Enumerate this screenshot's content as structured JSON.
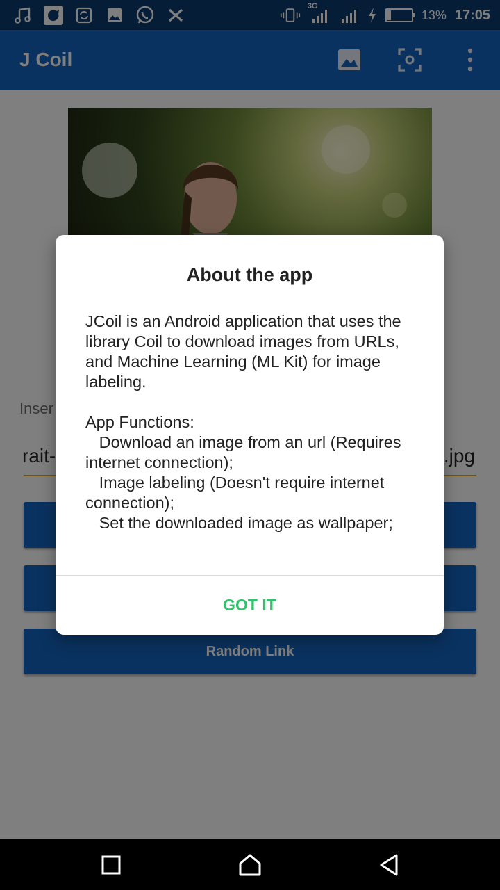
{
  "status_bar": {
    "battery_percent": "13%",
    "battery_level": 0.13,
    "time": "17:05",
    "network_label": "3G",
    "left_icons": [
      "music-note-icon",
      "app-icon",
      "sync-icon",
      "image-icon",
      "whatsapp-icon",
      "x-icon"
    ],
    "right_icons": [
      "vibrate-icon",
      "signal-3g-icon",
      "signal-icon",
      "charging-icon"
    ]
  },
  "app_bar": {
    "title": "J Coil",
    "actions": [
      "image-icon",
      "scan-icon",
      "more-vert-icon"
    ]
  },
  "main": {
    "insert_label": "Inser",
    "url_prefix": "rait-",
    "url_suffix": ".jpg",
    "buttons": [
      "",
      "",
      "Random Link"
    ]
  },
  "dialog": {
    "title": "About the app",
    "body": "JCoil is an Android application that uses the library Coil to download images from URLs, and Machine Learning (ML Kit) for image labeling.\n\nApp Functions:\n   Download an image from an url (Requires internet connection);\n   Image labeling (Doesn't require internet connection);\n   Set the downloaded image as wallpaper;",
    "button": "GOT IT"
  },
  "nav_bar": {
    "buttons": [
      "recents-icon",
      "home-icon",
      "back-icon"
    ]
  },
  "colors": {
    "status_bar": "#0b3a6e",
    "app_bar": "#1565c0",
    "accent": "#2ec46b",
    "input_underline": "#e6a618"
  }
}
